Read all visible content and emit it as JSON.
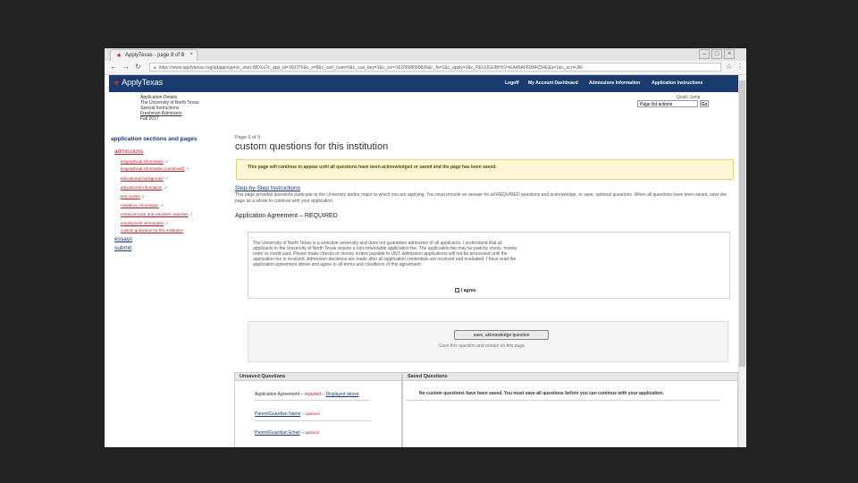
{
  "browser": {
    "tab_title": "ApplyTexas - page 8 of 8",
    "tab_close": "×",
    "url": "https://www.applytexas.org/adappc/gen/c_start.WDXa?c_app_id=160376&c_s=8&c_sort_num=0&c_sub_key=1&c_scr=1620608090696&c_fe=1&c_apply=0&c_PEUUGUBHXV=EA45AF6D84C54E&a=1&c_scr=UW",
    "icons": {
      "back": "back-icon",
      "forward": "forward-icon",
      "reload": "reload-icon",
      "lock": "lock-icon",
      "star": "star-icon",
      "menu": "menu-icon"
    }
  },
  "header": {
    "logo": "ApplyTexas",
    "nav": [
      "Logoff",
      "My Account Dashboard",
      "Admissions Information",
      "Application Instructions"
    ]
  },
  "app_info": {
    "lines": [
      "Application Details",
      "The University of North Texas",
      "Special Instructions",
      "Freshman Admission",
      "Fall 2017"
    ]
  },
  "quick_jump": {
    "label": "Quick Jump",
    "selected": "Page list actions",
    "go": "Go"
  },
  "sidebar": {
    "title": "application sections and pages",
    "admissions": "admissions",
    "pages": [
      {
        "label": "biographical information",
        "check": "✓"
      },
      {
        "label": "biographical information (continued)",
        "check": "✓"
      },
      {
        "label": "educational background",
        "check": "✓"
      },
      {
        "label": "educational information",
        "check": "✓"
      },
      {
        "label": "test scores",
        "check": "✓"
      },
      {
        "label": "residency information",
        "check": "✓"
      },
      {
        "label": "extracurricular and volunteer activities",
        "check": "✓"
      },
      {
        "label": "employment information",
        "check": "✓"
      },
      {
        "label": "custom questions for this institution",
        "check": ""
      }
    ],
    "essays": "essays",
    "submit": "submit"
  },
  "main": {
    "page_of": "Page 9 of 9",
    "title": "custom questions for this institution",
    "notice": "This page will continue to appear until all questions have been acknowledged or saved and the page has been saved.",
    "instructions_link": "Step-by-Step Instructions",
    "intro": "This page provides questions particular to the University and/or major to which you are applying. You must provide an answer for all REQUIRED questions and acknowledge, or save, optional questions. When all questions have been saved, save the page as a whole to continue with your application.",
    "agreement_heading": "Application Agreement – REQUIRED",
    "agreement_text": "The University of North Texas is a selective university and does not guarantee admission of all applicants. I understand that all applicants to the University of North Texas require a non-refundable application fee. The application fee may be paid by check, money order or credit card. Please make checks or money orders payable to UNT. Admission applications will not be processed until the application fee is received. Admission decisions are made after all application credentials are received and evaluated. I have read the application agreement above and agree to all terms and conditions of this agreement.",
    "agree_label": "I agree.",
    "save_button": "save, acknowledge question",
    "save_hint": "Save this question and remain on this page."
  },
  "unsaved": {
    "header": "Unsaved Questions",
    "items": [
      {
        "label": "Application Agreement",
        "status": "required",
        "extra": "Displayed above"
      },
      {
        "label": "Parent/Guardian Name",
        "status": "optional",
        "extra": ""
      },
      {
        "label": "Parent/Guardian Email",
        "status": "optional",
        "extra": ""
      }
    ]
  },
  "saved": {
    "header": "Saved Questions",
    "message": "No custom questions have been saved. You must save all questions before you can continue with your application."
  }
}
